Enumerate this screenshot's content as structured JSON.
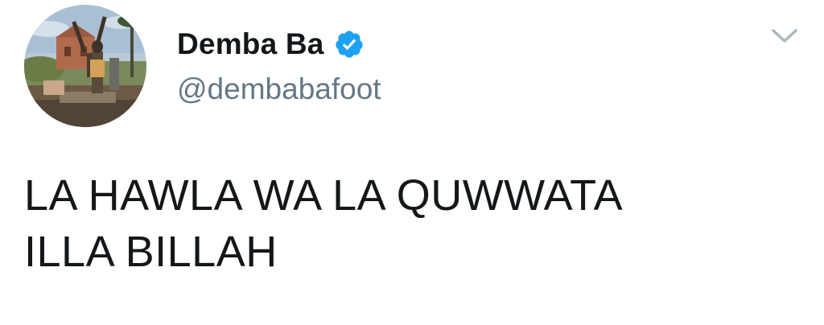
{
  "tweet": {
    "display_name": "Demba Ba",
    "handle": "@dembabafoot",
    "text_line_1": "LA HAWLA WA LA QUWWATA",
    "text_line_2": "ILLA BILLAH"
  },
  "icons": {
    "verified": "verified-badge-icon",
    "menu": "chevron-down-icon",
    "avatar": "profile-photo"
  },
  "colors": {
    "verified_blue": "#1da1f2",
    "name": "#14171a",
    "handle": "#657786",
    "caret": "#aab8c2"
  }
}
